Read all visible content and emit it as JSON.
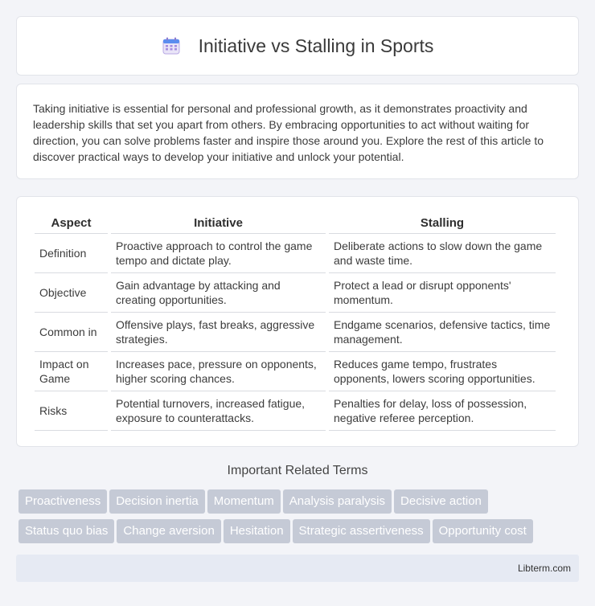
{
  "header": {
    "icon": "calendar-icon",
    "title": "Initiative vs Stalling in Sports"
  },
  "intro": {
    "text": "Taking initiative is essential for personal and professional growth, as it demonstrates proactivity and leadership skills that set you apart from others. By embracing opportunities to act without waiting for direction, you can solve problems faster and inspire those around you. Explore the rest of this article to discover practical ways to develop your initiative and unlock your potential."
  },
  "table": {
    "headers": [
      "Aspect",
      "Initiative",
      "Stalling"
    ],
    "rows": [
      [
        "Definition",
        "Proactive approach to control the game tempo and dictate play.",
        "Deliberate actions to slow down the game and waste time."
      ],
      [
        "Objective",
        "Gain advantage by attacking and creating opportunities.",
        "Protect a lead or disrupt opponents' momentum."
      ],
      [
        "Common in",
        "Offensive plays, fast breaks, aggressive strategies.",
        "Endgame scenarios, defensive tactics, time management."
      ],
      [
        "Impact on Game",
        "Increases pace, pressure on opponents, higher scoring chances.",
        "Reduces game tempo, frustrates opponents, lowers scoring opportunities."
      ],
      [
        "Risks",
        "Potential turnovers, increased fatigue, exposure to counterattacks.",
        "Penalties for delay, loss of possession, negative referee perception."
      ]
    ]
  },
  "related": {
    "heading": "Important Related Terms",
    "tags": [
      "Proactiveness",
      "Decision inertia",
      "Momentum",
      "Analysis paralysis",
      "Decisive action",
      "Status quo bias",
      "Change aversion",
      "Hesitation",
      "Strategic assertiveness",
      "Opportunity cost"
    ]
  },
  "footer": {
    "text": "Libterm.com"
  },
  "colors": {
    "background": "#f3f4f8",
    "tag_background": "#c5cad6",
    "footer_background": "#e6eaf3"
  }
}
